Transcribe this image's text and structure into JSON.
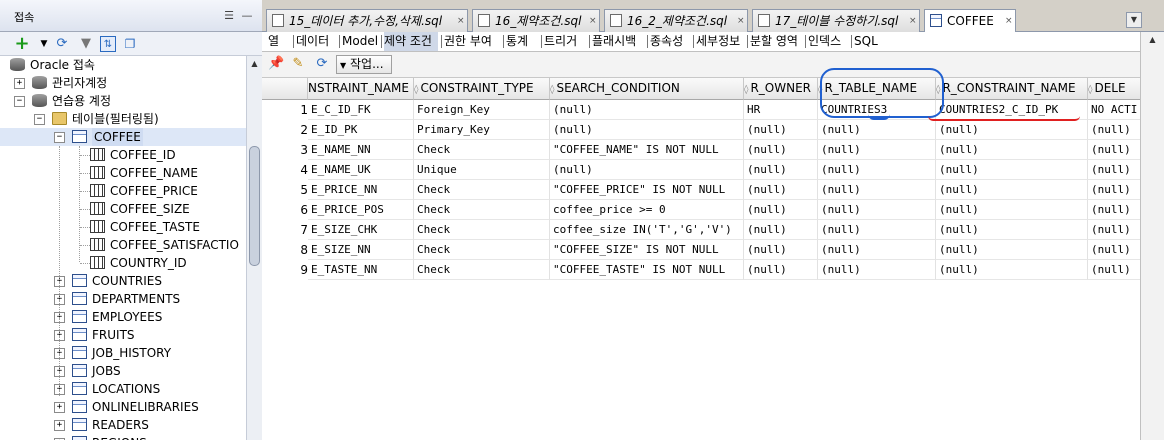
{
  "left_panel": {
    "title": "접속",
    "header_buttons": [
      "☰",
      "—"
    ],
    "toolbar_icons": [
      "add-icon",
      "dropdown-arrow-icon",
      "refresh-icon",
      "filter-icon",
      "schema-browser-icon",
      "window-icon"
    ],
    "tree": [
      {
        "label": "Oracle 접속",
        "level": 0,
        "icon": "database-icon",
        "exp": ""
      },
      {
        "label": "관리자계정",
        "level": 1,
        "icon": "connection-icon",
        "exp": "+"
      },
      {
        "label": "연습용 계정",
        "level": 1,
        "icon": "connection-icon",
        "exp": "−"
      },
      {
        "label": "테이블(필터링됨)",
        "level": 2,
        "icon": "folder-icon",
        "exp": "−"
      },
      {
        "label": "COFFEE",
        "level": 3,
        "icon": "table-icon",
        "exp": "−",
        "selected": true
      },
      {
        "label": "COFFEE_ID",
        "level": 4,
        "icon": "column-icon",
        "exp": ""
      },
      {
        "label": "COFFEE_NAME",
        "level": 4,
        "icon": "column-icon",
        "exp": ""
      },
      {
        "label": "COFFEE_PRICE",
        "level": 4,
        "icon": "column-icon",
        "exp": ""
      },
      {
        "label": "COFFEE_SIZE",
        "level": 4,
        "icon": "column-icon",
        "exp": ""
      },
      {
        "label": "COFFEE_TASTE",
        "level": 4,
        "icon": "column-icon",
        "exp": ""
      },
      {
        "label": "COFFEE_SATISFACTIO",
        "level": 4,
        "icon": "column-icon",
        "exp": ""
      },
      {
        "label": "COUNTRY_ID",
        "level": 4,
        "icon": "column-icon",
        "exp": ""
      },
      {
        "label": "COUNTRIES",
        "level": 3,
        "icon": "table-icon",
        "exp": "+"
      },
      {
        "label": "DEPARTMENTS",
        "level": 3,
        "icon": "table-icon",
        "exp": "+"
      },
      {
        "label": "EMPLOYEES",
        "level": 3,
        "icon": "table-icon",
        "exp": "+"
      },
      {
        "label": "FRUITS",
        "level": 3,
        "icon": "table-icon",
        "exp": "+"
      },
      {
        "label": "JOB_HISTORY",
        "level": 3,
        "icon": "table-icon",
        "exp": "+"
      },
      {
        "label": "JOBS",
        "level": 3,
        "icon": "table-icon",
        "exp": "+"
      },
      {
        "label": "LOCATIONS",
        "level": 3,
        "icon": "table-icon",
        "exp": "+"
      },
      {
        "label": "ONLINELIBRARIES",
        "level": 3,
        "icon": "table-icon",
        "exp": "+"
      },
      {
        "label": "READERS",
        "level": 3,
        "icon": "table-icon",
        "exp": "+"
      },
      {
        "label": "REGIONS",
        "level": 3,
        "icon": "table-icon",
        "exp": "+"
      }
    ]
  },
  "doc_tabs": [
    {
      "label": "15_데이터 추가,수정,삭제.sql",
      "active": false
    },
    {
      "label": "16_제약조건.sql",
      "active": false
    },
    {
      "label": "16_2_제약조건.sql",
      "active": false
    },
    {
      "label": "17_테이블 수정하기.sql",
      "active": false
    },
    {
      "label": "COFFEE",
      "active": true
    }
  ],
  "sub_tabs": [
    "열",
    "데이터",
    "Model",
    "제약 조건",
    "권한 부여",
    "통계",
    "트리거",
    "플래시백",
    "종속성",
    "세부정보",
    "분할 영역",
    "인덱스",
    "SQL"
  ],
  "active_sub_tab": "제약 조건",
  "data_toolbar": {
    "icons": [
      "pin-icon",
      "edit-icon",
      "refresh-icon"
    ],
    "action_label": "작업..."
  },
  "grid": {
    "columns": [
      "NSTRAINT_NAME",
      "CONSTRAINT_TYPE",
      "SEARCH_CONDITION",
      "R_OWNER",
      "R_TABLE_NAME",
      "R_CONSTRAINT_NAME",
      "DELE"
    ],
    "rows": [
      {
        "num": "1",
        "cells": [
          "E_C_ID_FK",
          "Foreign_Key",
          "(null)",
          "HR",
          "COUNTRIES3",
          "COUNTRIES2_C_ID_PK",
          "NO ACTI"
        ]
      },
      {
        "num": "2",
        "cells": [
          "E_ID_PK",
          "Primary_Key",
          "(null)",
          "(null)",
          "(null)",
          "(null)",
          "(null)"
        ]
      },
      {
        "num": "3",
        "cells": [
          "E_NAME_NN",
          "Check",
          "\"COFFEE_NAME\" IS NOT NULL",
          "(null)",
          "(null)",
          "(null)",
          "(null)"
        ]
      },
      {
        "num": "4",
        "cells": [
          "E_NAME_UK",
          "Unique",
          "(null)",
          "(null)",
          "(null)",
          "(null)",
          "(null)"
        ]
      },
      {
        "num": "5",
        "cells": [
          "E_PRICE_NN",
          "Check",
          "\"COFFEE_PRICE\" IS NOT NULL",
          "(null)",
          "(null)",
          "(null)",
          "(null)"
        ]
      },
      {
        "num": "6",
        "cells": [
          "E_PRICE_POS",
          "Check",
          "coffee_price >= 0",
          "(null)",
          "(null)",
          "(null)",
          "(null)"
        ]
      },
      {
        "num": "7",
        "cells": [
          "E_SIZE_CHK",
          "Check",
          "coffee_size IN('T','G','V')",
          "(null)",
          "(null)",
          "(null)",
          "(null)"
        ]
      },
      {
        "num": "8",
        "cells": [
          "E_SIZE_NN",
          "Check",
          "\"COFFEE_SIZE\" IS NOT NULL",
          "(null)",
          "(null)",
          "(null)",
          "(null)"
        ]
      },
      {
        "num": "9",
        "cells": [
          "E_TASTE_NN",
          "Check",
          "\"COFFEE_TASTE\" IS NOT NULL",
          "(null)",
          "(null)",
          "(null)",
          "(null)"
        ]
      }
    ]
  },
  "colors": {
    "annotation_circle": "#2060d0",
    "annotation_underline": "#e02020",
    "selection": "#dde7f7"
  }
}
